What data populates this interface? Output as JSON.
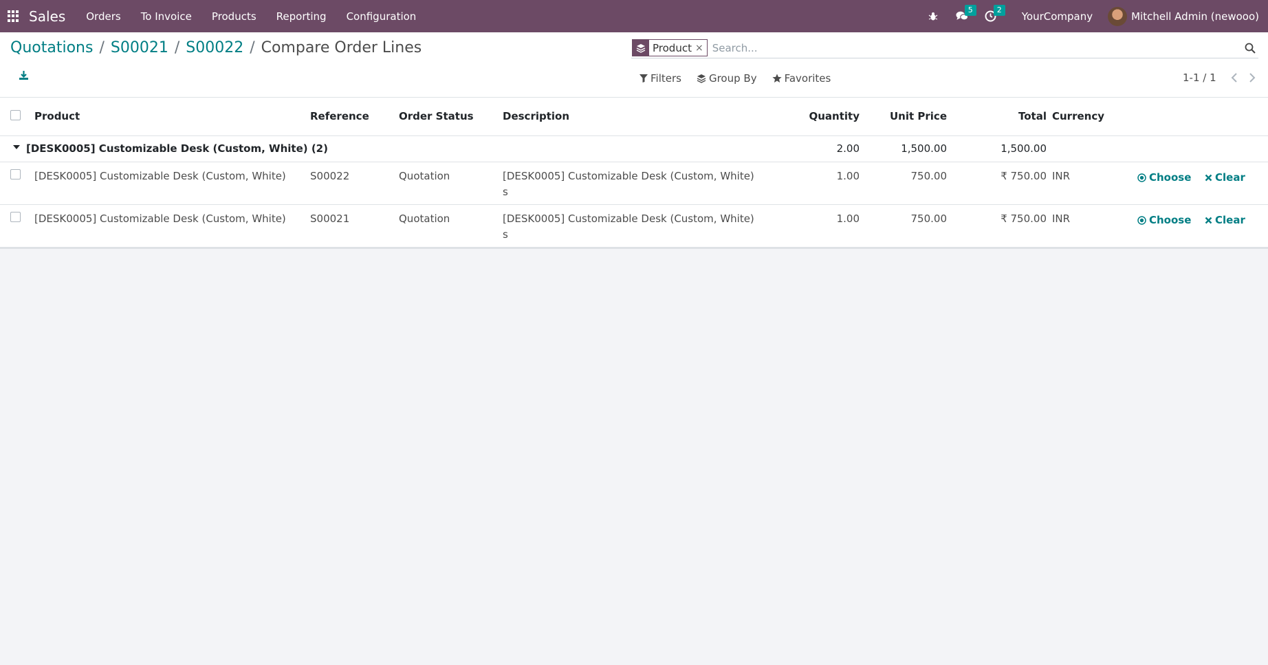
{
  "navbar": {
    "app_name": "Sales",
    "menu": [
      "Orders",
      "To Invoice",
      "Products",
      "Reporting",
      "Configuration"
    ],
    "messages_count": "5",
    "activities_count": "2",
    "company": "YourCompany",
    "user": "Mitchell Admin (newooo)"
  },
  "breadcrumb": {
    "items": [
      "Quotations",
      "S00021",
      "S00022"
    ],
    "separator": "/",
    "current": "Compare Order Lines"
  },
  "search": {
    "facet_label": "Product",
    "facet_remove": "×",
    "placeholder": "Search..."
  },
  "filters": {
    "filters_label": "Filters",
    "groupby_label": "Group By",
    "favorites_label": "Favorites"
  },
  "pager": {
    "value": "1-1 / 1"
  },
  "table": {
    "columns": {
      "product": "Product",
      "reference": "Reference",
      "status": "Order Status",
      "description": "Description",
      "quantity": "Quantity",
      "unit_price": "Unit Price",
      "total": "Total",
      "currency": "Currency"
    },
    "group": {
      "label": "[DESK0005] Customizable Desk (Custom, White) (2)",
      "quantity": "2.00",
      "unit_price": "1,500.00",
      "total": "1,500.00"
    },
    "rows": [
      {
        "product": "[DESK0005] Customizable Desk (Custom, White)",
        "reference": "S00022",
        "status": "Quotation",
        "description_line1": "[DESK0005] Customizable Desk (Custom, White)",
        "description_line2": "s",
        "quantity": "1.00",
        "unit_price": "750.00",
        "total": "₹ 750.00",
        "currency": "INR",
        "choose": "Choose",
        "clear": "Clear"
      },
      {
        "product": "[DESK0005] Customizable Desk (Custom, White)",
        "reference": "S00021",
        "status": "Quotation",
        "description_line1": "[DESK0005] Customizable Desk (Custom, White)",
        "description_line2": "s",
        "quantity": "1.00",
        "unit_price": "750.00",
        "total": "₹ 750.00",
        "currency": "INR",
        "choose": "Choose",
        "clear": "Clear"
      }
    ]
  },
  "colors": {
    "navbar": "#6c4a65",
    "link": "#017e84",
    "price_green": "#1c8a2c",
    "badge": "#00a09d",
    "background": "#f3f4f7"
  }
}
